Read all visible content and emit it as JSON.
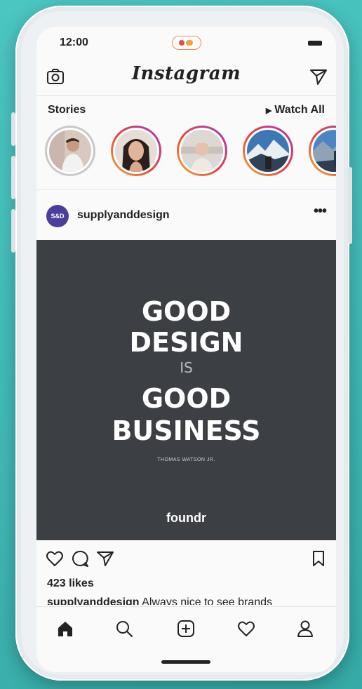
{
  "status_bar": {
    "time": "12:00"
  },
  "header": {
    "app_title": "Instagram",
    "camera_icon": "camera-icon",
    "direct_icon": "paper-plane-icon"
  },
  "stories": {
    "title": "Stories",
    "watch_all_label": "Watch All",
    "items": [
      {
        "seen": true
      },
      {
        "seen": false
      },
      {
        "seen": false
      },
      {
        "seen": false
      },
      {
        "seen": false
      }
    ]
  },
  "post": {
    "avatar_text": "S&D",
    "username": "supplyanddesign",
    "more_label": "•••",
    "image": {
      "line1": "GOOD",
      "line2": "DESIGN",
      "line3": "IS",
      "line4": "GOOD",
      "line5": "BUSINESS",
      "author": "THOMAS WATSON JR.",
      "brand": "foundr"
    },
    "likes": "423 likes",
    "caption_user": "supplyanddesign",
    "caption_text": "Always nice to see brands"
  },
  "tabbar": {
    "icons": [
      "home-icon",
      "search-icon",
      "add-post-icon",
      "activity-heart-icon",
      "profile-icon"
    ]
  },
  "colors": {
    "background": "#44bfba",
    "post_image_bg": "#3c3f44",
    "avatar_bg": "#4b3f9b",
    "story_ring_start": "#f6b13f",
    "story_ring_end": "#7e3fb0"
  }
}
